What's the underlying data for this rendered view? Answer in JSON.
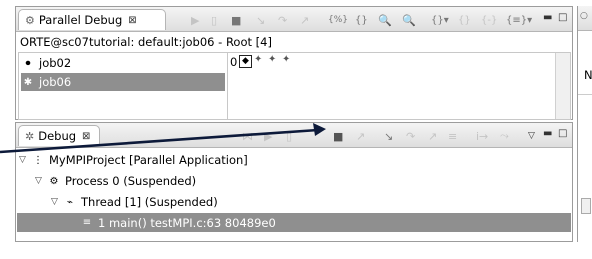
{
  "parallel_debug": {
    "tab_label": "Parallel Debug",
    "close_glyph": "⊠",
    "minimize": "▬",
    "maximize": "□",
    "toolbar_icons": [
      "resume-icon",
      "suspend-icon",
      "terminate-icon",
      "step-into-icon",
      "step-over-icon",
      "step-return-icon",
      "register-icon",
      "braces-icon",
      "zoom-in-icon",
      "zoom-out-icon",
      "set-icon",
      "create-set-icon",
      "delete-set-icon",
      "view-menu-icon"
    ],
    "job_title": "ORTE@sc07tutorial: default:job06 - Root [4]",
    "jobs": [
      {
        "name": "job02",
        "icon": "job-running-icon",
        "selected": false
      },
      {
        "name": "job06",
        "icon": "job-active-icon",
        "selected": true
      }
    ],
    "process_set_label": "0",
    "process_icons": [
      "process-selected-icon",
      "process-icon",
      "process-icon",
      "process-icon"
    ]
  },
  "debug_view": {
    "tab_label": "Debug",
    "close_glyph": "⊠",
    "tree": [
      {
        "label": "MyMPIProject [Parallel Application]",
        "icon": "launch-icon",
        "level": 0,
        "expanded": true
      },
      {
        "label": "Process 0 (Suspended)",
        "icon": "process-gear-icon",
        "level": 1,
        "expanded": true
      },
      {
        "label": "Thread [1] (Suspended)",
        "icon": "thread-icon",
        "level": 2,
        "expanded": true
      },
      {
        "label": "1 main() testMPI.c:63 80489e0",
        "icon": "stack-frame-icon",
        "level": 3,
        "selected": true
      }
    ]
  },
  "right_pane": {
    "partial_label": "N"
  },
  "colors": {
    "selection": "#8f8f8f",
    "arrow": "#0d1a3a"
  }
}
